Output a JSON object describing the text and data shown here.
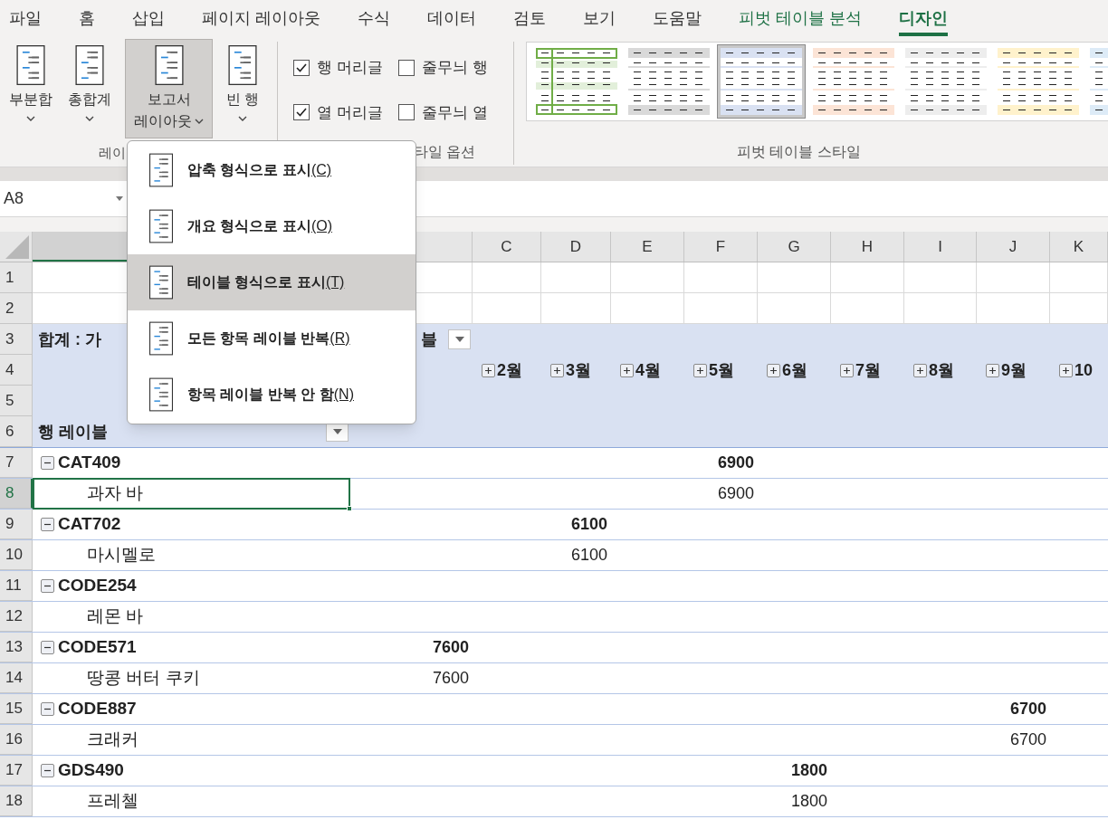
{
  "ribbon": {
    "tabs": [
      {
        "label": "파일",
        "selected": false,
        "contextual": false
      },
      {
        "label": "홈",
        "selected": false,
        "contextual": false
      },
      {
        "label": "삽입",
        "selected": false,
        "contextual": false
      },
      {
        "label": "페이지 레이아웃",
        "selected": false,
        "contextual": false
      },
      {
        "label": "수식",
        "selected": false,
        "contextual": false
      },
      {
        "label": "데이터",
        "selected": false,
        "contextual": false
      },
      {
        "label": "검토",
        "selected": false,
        "contextual": false
      },
      {
        "label": "보기",
        "selected": false,
        "contextual": false
      },
      {
        "label": "도움말",
        "selected": false,
        "contextual": false
      },
      {
        "label": "피벗 테이블 분석",
        "selected": false,
        "contextual": true
      },
      {
        "label": "디자인",
        "selected": true,
        "contextual": true
      }
    ],
    "buttons": [
      {
        "lines": [
          "부분합"
        ],
        "pressed": false
      },
      {
        "lines": [
          "총합계"
        ],
        "pressed": false
      },
      {
        "lines": [
          "보고서",
          "레이아웃"
        ],
        "pressed": true
      },
      {
        "lines": [
          "빈 행"
        ],
        "pressed": false
      }
    ],
    "layout_group_label": "레이",
    "checkboxes": [
      {
        "label": "행 머리글",
        "checked": true
      },
      {
        "label": "줄무늬 행",
        "checked": false
      },
      {
        "label": "열 머리글",
        "checked": true
      },
      {
        "label": "줄무늬 열",
        "checked": false
      }
    ],
    "options_group_label": "타일 옵션",
    "styles": [
      {
        "kind": "outlined",
        "color": "#70ad47",
        "selected": false
      },
      {
        "kind": "banded",
        "color": "#d9d9d9",
        "selected": false
      },
      {
        "kind": "banded",
        "color": "#d9e1f2",
        "selected": true
      },
      {
        "kind": "banded",
        "color": "#fce4d6",
        "selected": false
      },
      {
        "kind": "banded",
        "color": "#ededed",
        "selected": false
      },
      {
        "kind": "banded",
        "color": "#fff2cc",
        "selected": false
      },
      {
        "kind": "banded",
        "color": "#ddebf7",
        "selected": false
      }
    ],
    "styles_group_label": "피벗 테이블 스타일"
  },
  "name_box": "A8",
  "columns": [
    "C",
    "D",
    "E",
    "F",
    "G",
    "H",
    "I",
    "J",
    "K"
  ],
  "row_headers": [
    {
      "label": "1",
      "selected": false
    },
    {
      "label": "2",
      "selected": false
    },
    {
      "label": "3",
      "selected": false
    },
    {
      "label": "4",
      "selected": false
    },
    {
      "label": "5",
      "selected": false
    },
    {
      "label": "6",
      "selected": false
    },
    {
      "label": "7",
      "selected": false
    },
    {
      "label": "8",
      "selected": true
    },
    {
      "label": "9",
      "selected": false
    },
    {
      "label": "10",
      "selected": false
    },
    {
      "label": "11",
      "selected": false
    },
    {
      "label": "12",
      "selected": false
    },
    {
      "label": "13",
      "selected": false
    },
    {
      "label": "14",
      "selected": false
    },
    {
      "label": "15",
      "selected": false
    },
    {
      "label": "16",
      "selected": false
    },
    {
      "label": "17",
      "selected": false
    },
    {
      "label": "18",
      "selected": false
    }
  ],
  "pivot": {
    "title_start": "합계 : 가",
    "title_end": "블",
    "months": [
      {
        "label": "2월",
        "expanded": false
      },
      {
        "label": "3월",
        "expanded": false
      },
      {
        "label": "4월",
        "expanded": false
      },
      {
        "label": "5월",
        "expanded": false
      },
      {
        "label": "6월",
        "expanded": false
      },
      {
        "label": "7월",
        "expanded": false
      },
      {
        "label": "8월",
        "expanded": false
      },
      {
        "label": "9월",
        "expanded": false
      },
      {
        "label": "10",
        "expanded": false
      }
    ],
    "row_header": "행 레이블",
    "rows": [
      {
        "kind": "group",
        "label": "CAT409",
        "expanded": true,
        "cells": {
          "F": "6900"
        }
      },
      {
        "kind": "item",
        "label": "과자 바",
        "cells": {
          "F": "6900"
        }
      },
      {
        "kind": "group",
        "label": "CAT702",
        "expanded": true,
        "cells": {
          "D": "6100"
        }
      },
      {
        "kind": "item",
        "label": "마시멜로",
        "cells": {
          "D": "6100"
        }
      },
      {
        "kind": "group",
        "label": "CODE254",
        "expanded": true,
        "cells": {}
      },
      {
        "kind": "item",
        "label": "레몬 바",
        "cells": {}
      },
      {
        "kind": "group",
        "label": "CODE571",
        "expanded": true,
        "cells": {
          "B": "7600"
        }
      },
      {
        "kind": "item",
        "label": "땅콩 버터 쿠키",
        "cells": {
          "B": "7600"
        }
      },
      {
        "kind": "group",
        "label": "CODE887",
        "expanded": true,
        "cells": {
          "J": "6700"
        }
      },
      {
        "kind": "item",
        "label": "크래커",
        "cells": {
          "J": "6700"
        }
      },
      {
        "kind": "group",
        "label": "GDS490",
        "expanded": true,
        "cells": {
          "G": "1800"
        }
      },
      {
        "kind": "item",
        "label": "프레첼",
        "cells": {
          "G": "1800"
        }
      }
    ]
  },
  "menu": {
    "items": [
      {
        "label": "압축 형식으로 표시",
        "hotkey": "(C)",
        "selected": false
      },
      {
        "label": "개요 형식으로 표시",
        "hotkey": "(O)",
        "selected": false
      },
      {
        "label": "테이블 형식으로 표시",
        "hotkey": "(T)",
        "selected": true
      },
      {
        "label": "모든 항목 레이블 반복",
        "hotkey": "(R)",
        "selected": false
      },
      {
        "label": "항목 레이블 반복 안 함",
        "hotkey": "(N)",
        "selected": false
      }
    ]
  }
}
